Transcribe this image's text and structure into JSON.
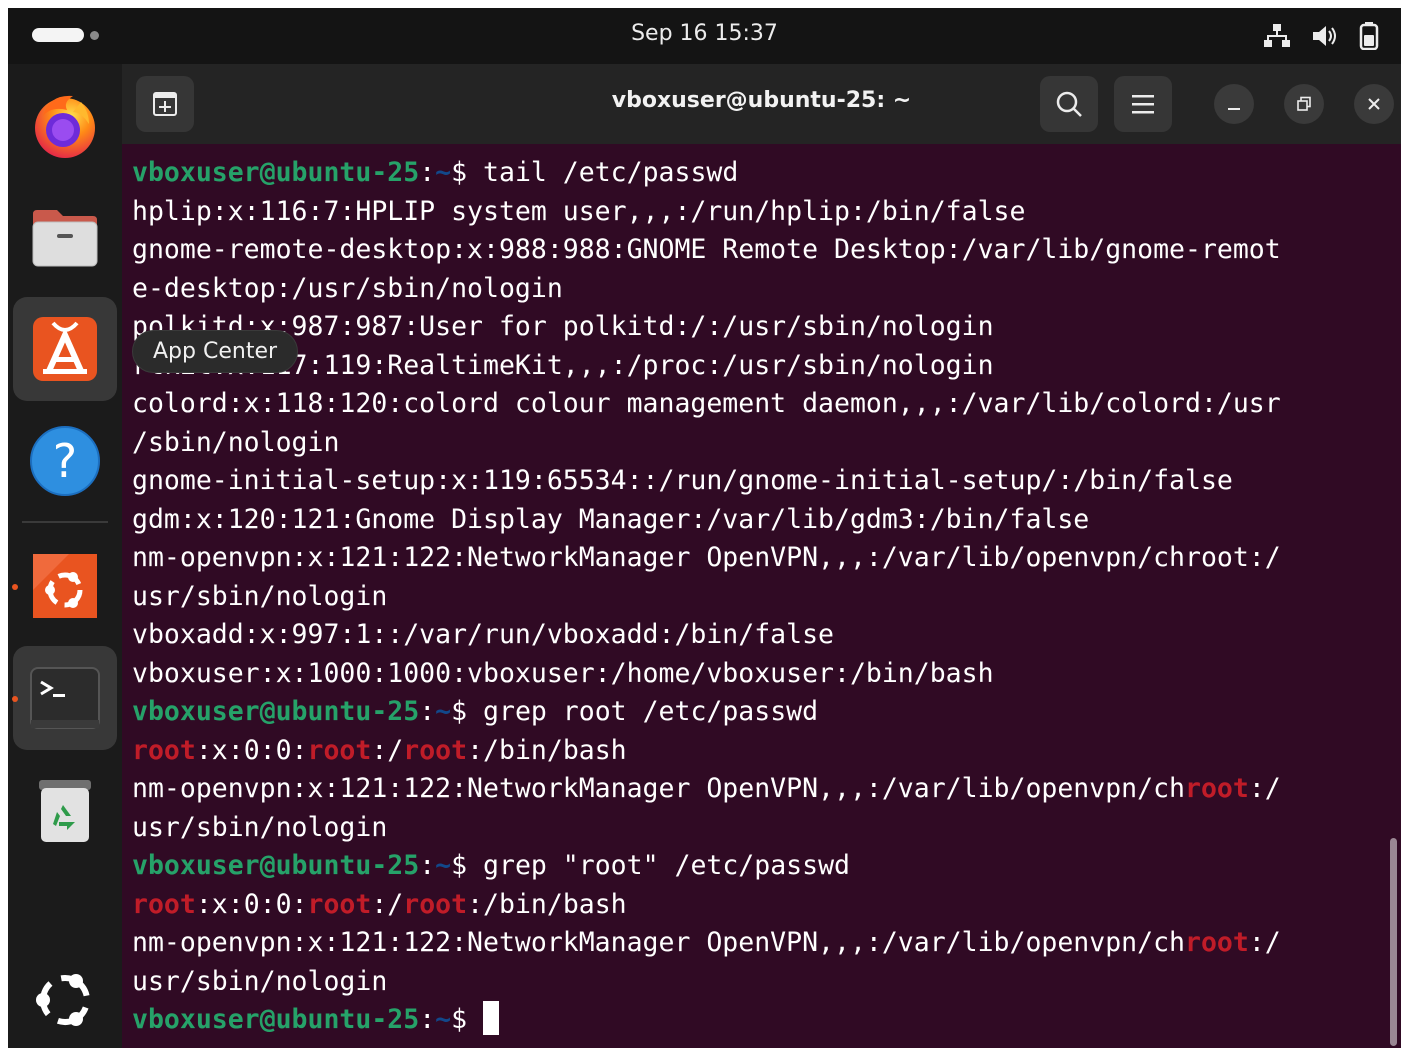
{
  "topbar": {
    "clock": "Sep 16  15:37",
    "tray_icons": [
      "network-icon",
      "volume-icon",
      "battery-icon"
    ]
  },
  "dock": {
    "items": [
      {
        "name": "firefox",
        "icon": "firefox-icon",
        "running": false
      },
      {
        "name": "files",
        "icon": "folder-icon",
        "running": false
      },
      {
        "name": "app-center",
        "icon": "app-center-icon",
        "running": false,
        "hovered": true
      },
      {
        "name": "help",
        "icon": "help-icon",
        "running": false
      },
      {
        "name": "ubuntu-software",
        "icon": "ubuntu-app-icon",
        "running": true
      },
      {
        "name": "terminal",
        "icon": "terminal-icon",
        "running": true,
        "focused": true
      },
      {
        "name": "trash",
        "icon": "trash-icon",
        "running": false
      }
    ],
    "tooltip": "App Center",
    "show_apps_icon": "ubuntu-logo-icon"
  },
  "terminal": {
    "title": "vboxuser@ubuntu-25: ~",
    "prompt_user": "vboxuser@ubuntu-25",
    "prompt_path": "~",
    "prompt_suffix": "$",
    "highlight_word": "root",
    "colors": {
      "background": "#300a24",
      "prompt_user": "#26a269",
      "prompt_path": "#12488b",
      "highlight": "#c01c28"
    },
    "lines": [
      {
        "type": "prompt",
        "cmd": "tail /etc/passwd"
      },
      {
        "type": "out",
        "text": "hplip:x:116:7:HPLIP system user,,,:/run/hplip:/bin/false"
      },
      {
        "type": "out",
        "text": "gnome-remote-desktop:x:988:988:GNOME Remote Desktop:/var/lib/gnome-remot"
      },
      {
        "type": "out",
        "text": "e-desktop:/usr/sbin/nologin"
      },
      {
        "type": "out",
        "text": "polkitd:x:987:987:User for polkitd:/:/usr/sbin/nologin"
      },
      {
        "type": "out",
        "text": "rtkit:x:117:119:RealtimeKit,,,:/proc:/usr/sbin/nologin"
      },
      {
        "type": "out",
        "text": "colord:x:118:120:colord colour management daemon,,,:/var/lib/colord:/usr"
      },
      {
        "type": "out",
        "text": "/sbin/nologin"
      },
      {
        "type": "out",
        "text": "gnome-initial-setup:x:119:65534::/run/gnome-initial-setup/:/bin/false"
      },
      {
        "type": "out",
        "text": "gdm:x:120:121:Gnome Display Manager:/var/lib/gdm3:/bin/false"
      },
      {
        "type": "out",
        "text": "nm-openvpn:x:121:122:NetworkManager OpenVPN,,,:/var/lib/openvpn/chroot:/"
      },
      {
        "type": "out",
        "text": "usr/sbin/nologin"
      },
      {
        "type": "out",
        "text": "vboxadd:x:997:1::/var/run/vboxadd:/bin/false"
      },
      {
        "type": "out",
        "text": "vboxuser:x:1000:1000:vboxuser:/home/vboxuser:/bin/bash"
      },
      {
        "type": "prompt",
        "cmd": "grep root /etc/passwd"
      },
      {
        "type": "match",
        "text": "root:x:0:0:root:/root:/bin/bash"
      },
      {
        "type": "match",
        "text": "nm-openvpn:x:121:122:NetworkManager OpenVPN,,,:/var/lib/openvpn/chroot:/"
      },
      {
        "type": "out",
        "text": "usr/sbin/nologin"
      },
      {
        "type": "prompt",
        "cmd": "grep \"root\" /etc/passwd"
      },
      {
        "type": "match",
        "text": "root:x:0:0:root:/root:/bin/bash"
      },
      {
        "type": "match",
        "text": "nm-openvpn:x:121:122:NetworkManager OpenVPN,,,:/var/lib/openvpn/chroot:/"
      },
      {
        "type": "out",
        "text": "usr/sbin/nologin"
      },
      {
        "type": "prompt",
        "cmd": "",
        "cursor": true
      }
    ]
  }
}
